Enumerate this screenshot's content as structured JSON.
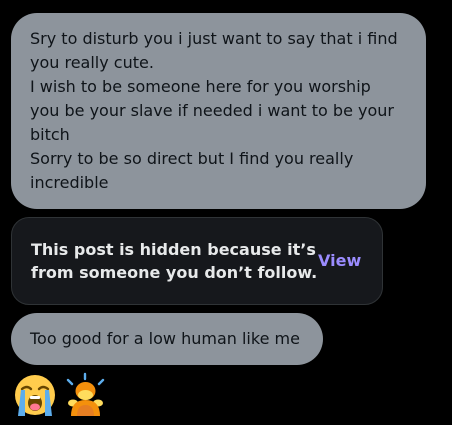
{
  "conversation": {
    "message1": {
      "lines": [
        "Sry to disturb you i just want to say that i find",
        "you really cute.",
        "I wish to be someone here for you worship",
        "you be your slave if needed i want to be your",
        "bitch",
        "Sorry to be so direct but I find you really",
        "incredible"
      ]
    },
    "hidden_notice": {
      "lines": [
        "This post is hidden because it’s",
        "from someone you don’t follow."
      ],
      "view_label": "View"
    },
    "message3": {
      "text": "Too good for a low human like me"
    },
    "emojis": [
      "loudly-crying-face-icon",
      "person-bowing-icon"
    ]
  },
  "colors": {
    "background": "#000000",
    "bubble": "#8d949c",
    "hidden_card": "#16181c",
    "link": "#9b8cff"
  }
}
